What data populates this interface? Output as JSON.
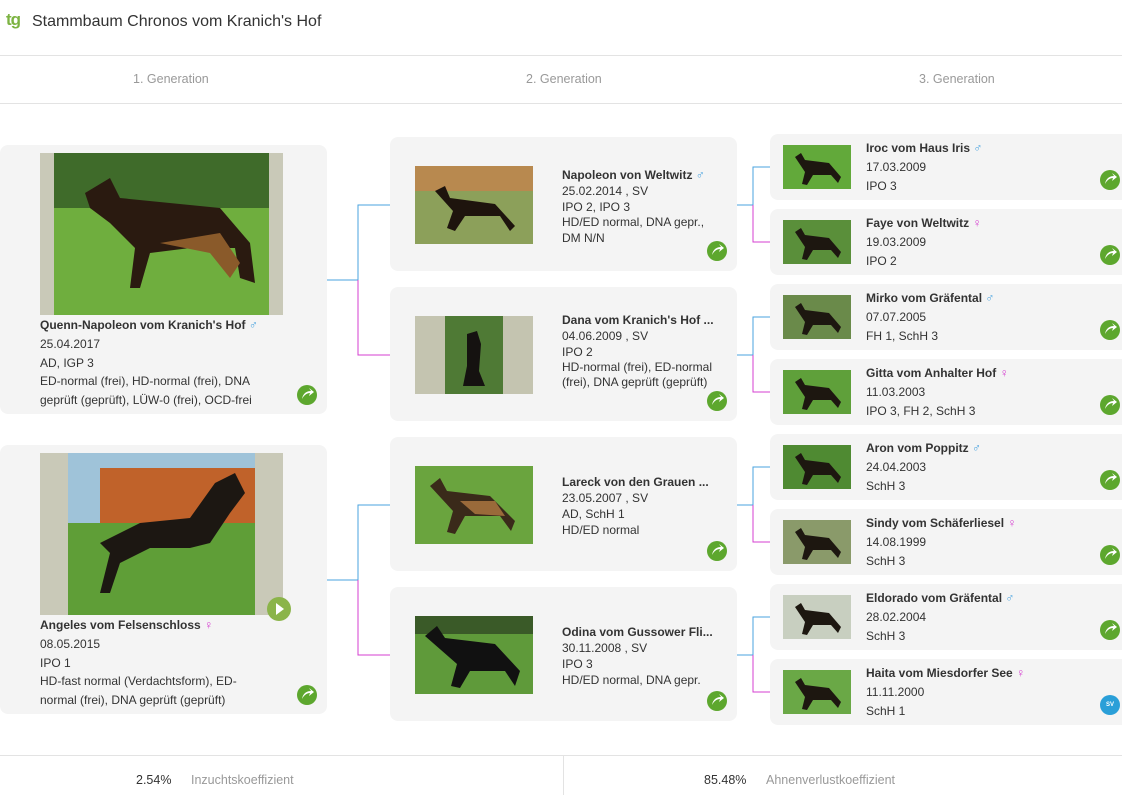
{
  "header": {
    "logo_text": "tg",
    "title": "Stammbaum Chronos vom Kranich's Hof"
  },
  "generations": [
    "1. Generation",
    "2. Generation",
    "3. Generation"
  ],
  "gen1": [
    {
      "name": "Quenn-Napoleon vom Kranich's Hof",
      "sex": "♂",
      "date": "25.04.2017",
      "titles": "AD, IGP 3",
      "health": "ED-normal (frei), HD-normal (frei), DNA geprüft (geprüft), LÜW-0 (frei), OCD-frei"
    },
    {
      "name": "Angeles vom Felsenschloss",
      "sex": "♀",
      "date": "08.05.2015",
      "titles": "IPO 1",
      "health": "HD-fast normal (Verdachtsform), ED-normal (frei), DNA geprüft (geprüft)"
    }
  ],
  "gen2": [
    {
      "name": "Napoleon von Weltwitz",
      "sex": "♂",
      "date": "25.02.2014 , SV",
      "titles": "IPO 2, IPO 3",
      "health": "HD/ED normal, DNA gepr., DM N/N"
    },
    {
      "name": "Dana vom Kranich's Hof ...",
      "sex": "",
      "date": "04.06.2009 , SV",
      "titles": "IPO 2",
      "health": "HD-normal (frei), ED-normal (frei), DNA geprüft (geprüft)"
    },
    {
      "name": "Lareck von den Grauen ...",
      "sex": "",
      "date": "23.05.2007 , SV",
      "titles": "AD, SchH 1",
      "health": "HD/ED normal"
    },
    {
      "name": "Odina vom Gussower Fli...",
      "sex": "",
      "date": "30.11.2008 , SV",
      "titles": "IPO 3",
      "health": "HD/ED normal, DNA gepr."
    }
  ],
  "gen3": [
    {
      "name": "Iroc vom Haus Iris",
      "sex": "♂",
      "date": "17.03.2009",
      "titles": "IPO 3"
    },
    {
      "name": "Faye von Weltwitz",
      "sex": "♀",
      "date": "19.03.2009",
      "titles": "IPO 2"
    },
    {
      "name": "Mirko vom Gräfental",
      "sex": "♂",
      "date": "07.07.2005",
      "titles": "FH 1, SchH 3"
    },
    {
      "name": "Gitta vom Anhalter Hof",
      "sex": "♀",
      "date": "11.03.2003",
      "titles": "IPO 3, FH 2, SchH 3"
    },
    {
      "name": "Aron vom Poppitz",
      "sex": "♂",
      "date": "24.04.2003",
      "titles": "SchH 3"
    },
    {
      "name": "Sindy vom Schäferliesel",
      "sex": "♀",
      "date": "14.08.1999",
      "titles": "SchH 3"
    },
    {
      "name": "Eldorado vom Gräfental",
      "sex": "♂",
      "date": "28.02.2004",
      "titles": "SchH 3"
    },
    {
      "name": "Haita vom Miesdorfer See",
      "sex": "♀",
      "date": "11.11.2000",
      "titles": "SchH 1"
    }
  ],
  "footer": {
    "inbreeding_value": "2.54%",
    "inbreeding_label": "Inzuchtskoeffizient",
    "ancestor_loss_value": "85.48%",
    "ancestor_loss_label": "Ahnenverlustkoeffizient"
  },
  "colors": {
    "male": "#4aa3df",
    "female": "#d53fd0",
    "accent": "#7cb342"
  },
  "icons": {
    "card_link": "arrow-circle-icon",
    "video": "play-icon",
    "badge": "club-badge-icon"
  }
}
